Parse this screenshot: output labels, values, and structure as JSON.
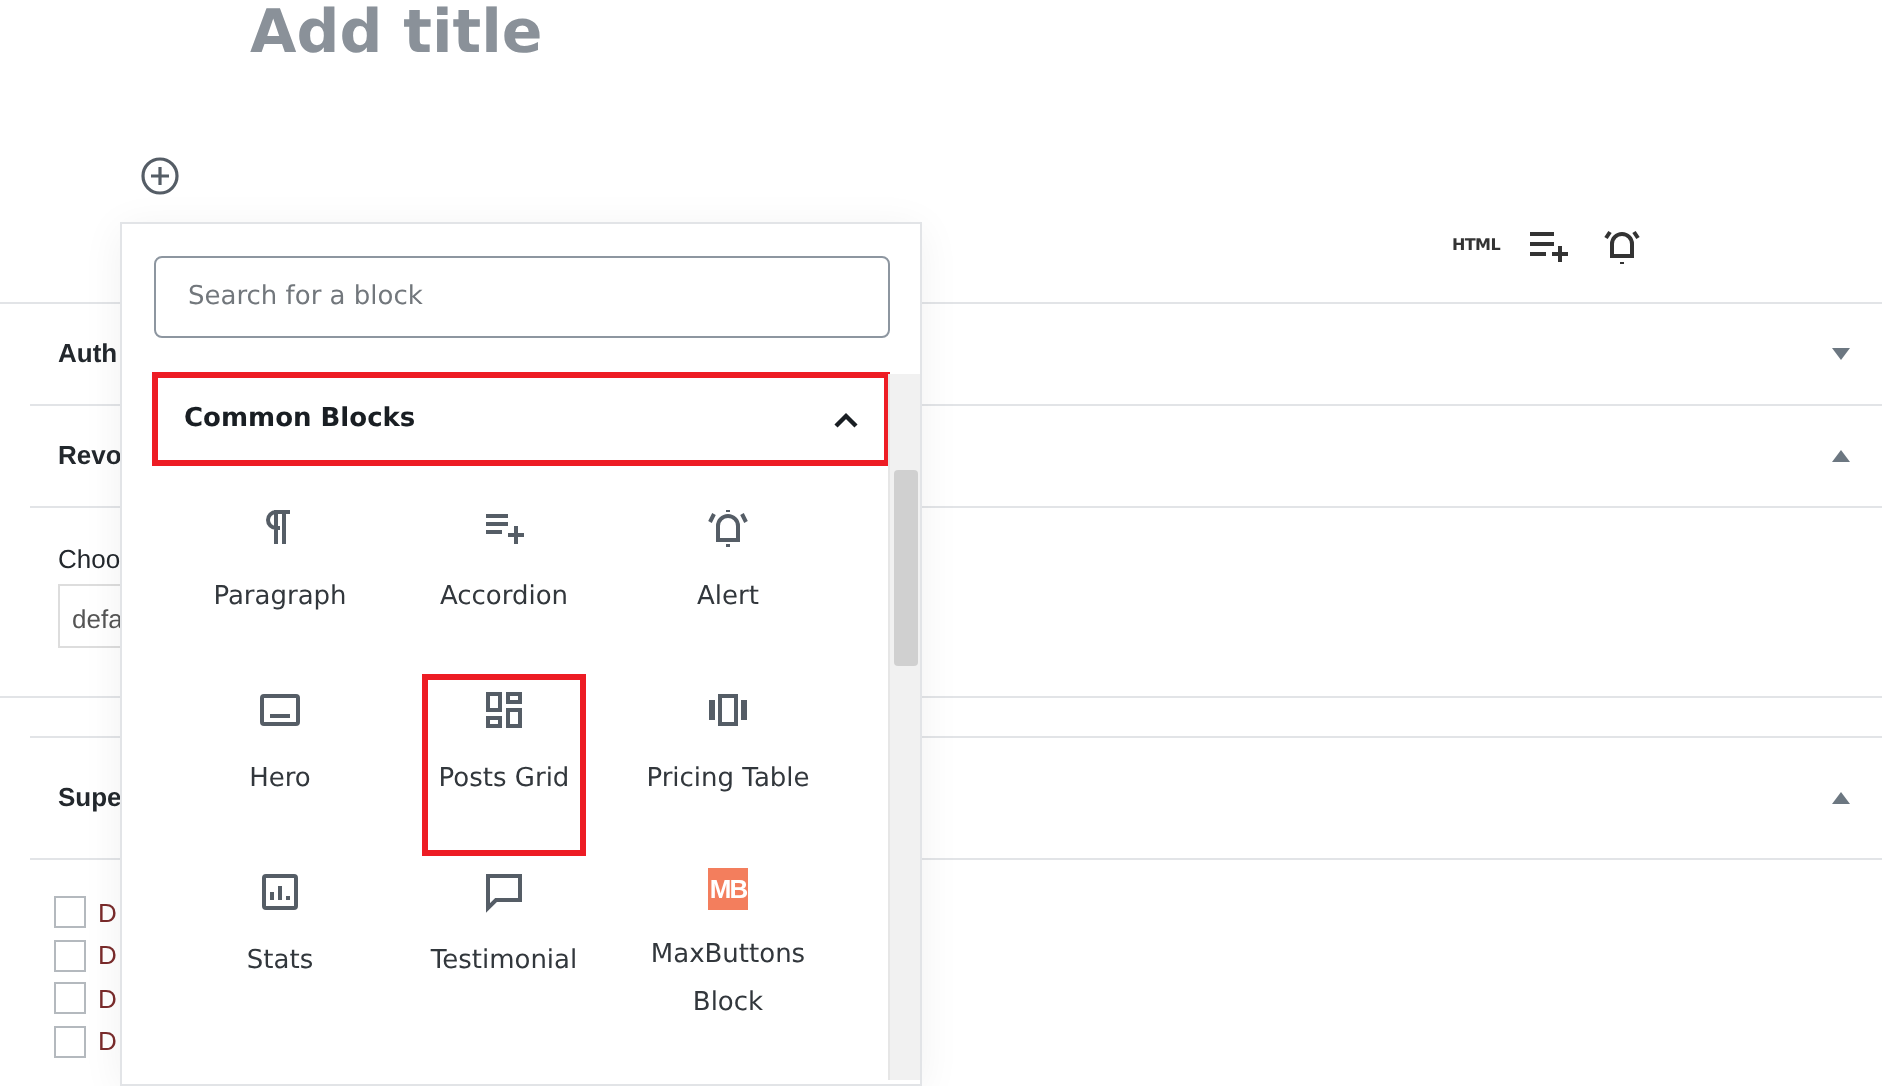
{
  "title_placeholder": "Add title",
  "toolbar": {
    "html_label": "HTML"
  },
  "sections": [
    {
      "title": "Auth",
      "expanded": false
    },
    {
      "title": "Revo",
      "expanded": true,
      "field_label": "Choo",
      "select_value": "defa"
    },
    {
      "title": "Supe",
      "expanded": true,
      "checkboxes": [
        {
          "label": "D",
          "checked": false
        },
        {
          "label": "D",
          "checked": false
        },
        {
          "label": "D",
          "checked": false
        },
        {
          "label": "D",
          "checked": false
        }
      ]
    }
  ],
  "inserter": {
    "search": {
      "placeholder": "Search for a block"
    },
    "category": {
      "title": "Common Blocks",
      "expanded": true,
      "highlighted": true
    },
    "blocks": [
      {
        "label": "Paragraph",
        "highlighted": false
      },
      {
        "label": "Accordion",
        "highlighted": false
      },
      {
        "label": "Alert",
        "highlighted": false
      },
      {
        "label": "Hero",
        "highlighted": false
      },
      {
        "label": "Posts Grid",
        "highlighted": true
      },
      {
        "label": "Pricing Table",
        "highlighted": false
      },
      {
        "label": "Stats",
        "highlighted": false
      },
      {
        "label": "Testimonial",
        "highlighted": false
      },
      {
        "label": "MaxButtons Block",
        "highlighted": false,
        "logo_text": "MB"
      }
    ]
  }
}
